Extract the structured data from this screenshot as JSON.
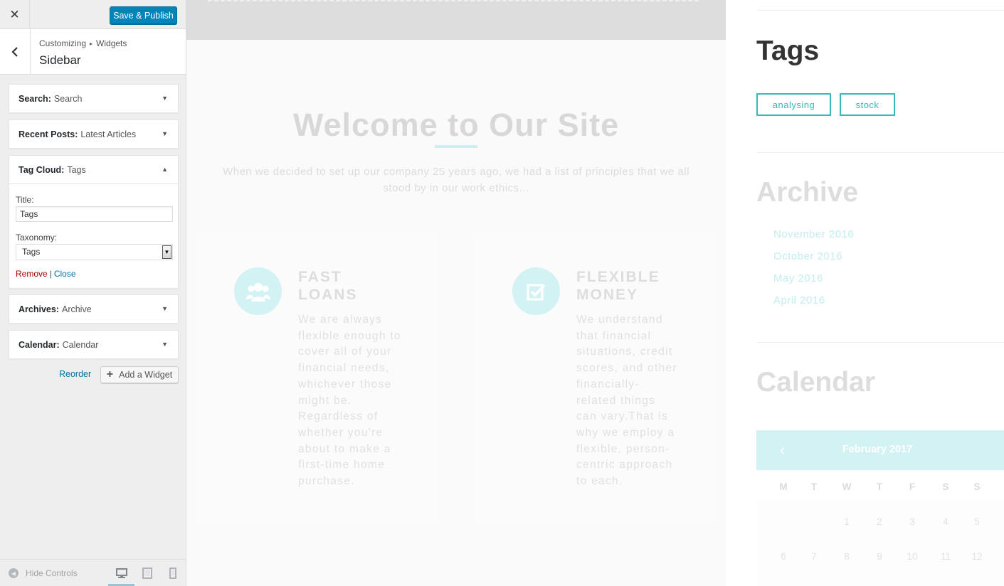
{
  "customizer": {
    "close_icon": "close-icon",
    "save_label": "Save & Publish",
    "breadcrumb": [
      "Customizing",
      "Widgets"
    ],
    "breadcrumb_sep": "▸",
    "section_title": "Sidebar",
    "widgets": [
      {
        "type": "Search:",
        "name": "Search",
        "expanded": false
      },
      {
        "type": "Recent Posts:",
        "name": "Latest Articles",
        "expanded": false
      },
      {
        "type": "Tag Cloud:",
        "name": "Tags",
        "expanded": true
      },
      {
        "type": "Archives:",
        "name": "Archive",
        "expanded": false
      },
      {
        "type": "Calendar:",
        "name": "Calendar",
        "expanded": false
      }
    ],
    "tag_cloud_form": {
      "title_label": "Title:",
      "title_value": "Tags",
      "taxonomy_label": "Taxonomy:",
      "taxonomy_value": "Tags",
      "remove_label": "Remove",
      "sep": "|",
      "close_label": "Close"
    },
    "reorder_label": "Reorder",
    "add_widget_label": "Add a Widget",
    "hide_controls_label": "Hide Controls",
    "active_device": "desktop"
  },
  "preview": {
    "welcome_title": "Welcome to Our Site",
    "welcome_text": "When we decided to set up our company 25 years ago, we had a list of principles that we all stood by in our work ethics...",
    "features": [
      {
        "title": "FAST LOANS",
        "icon": "users-icon",
        "text": "We are always flexible enough to cover all of your financial needs, whichever those might be. Regardless of whether you're about to make a first-time home purchase."
      },
      {
        "title": "FLEXIBLE MONEY",
        "icon": "checkbox-icon",
        "text": "We understand that financial situations, credit scores, and other financially-related things can vary.That is why we employ a flexible, person-centric approach to each."
      }
    ],
    "sidebar": {
      "tags_title": "Tags",
      "tags": [
        "analysing",
        "stock"
      ],
      "archive_title": "Archive",
      "archive_items": [
        "November 2016",
        "October 2016",
        "May 2016",
        "April 2016"
      ],
      "calendar_title": "Calendar",
      "calendar_month": "February 2017",
      "weekdays": [
        "M",
        "T",
        "W",
        "T",
        "F",
        "S",
        "S"
      ],
      "week1": [
        "",
        "",
        "1",
        "2",
        "3",
        "4",
        "5"
      ],
      "week2": [
        "6",
        "7",
        "8",
        "9",
        "10",
        "11",
        "12"
      ]
    }
  },
  "colors": {
    "primary_button": "#0085ba",
    "link": "#0073aa",
    "remove_link": "#aa0000",
    "accent_teal": "#37b8bd",
    "accent_teal_light": "#d3f2f3"
  }
}
